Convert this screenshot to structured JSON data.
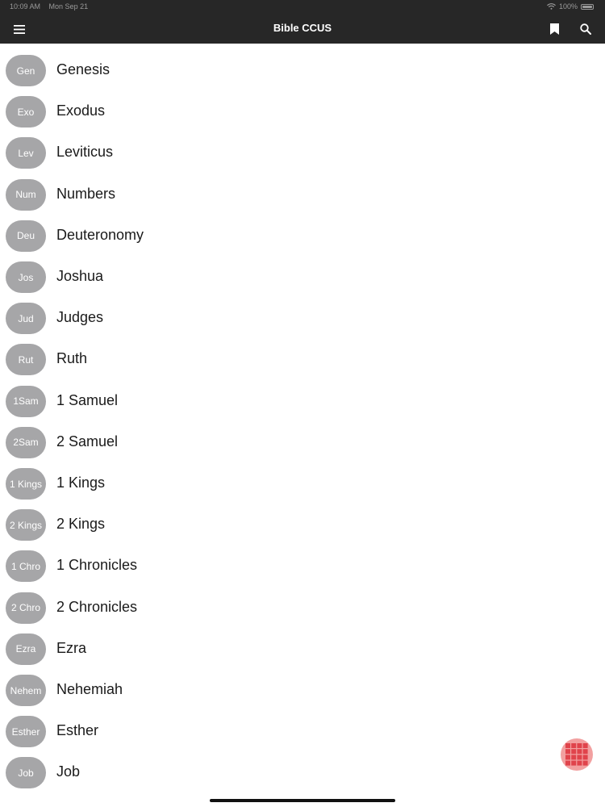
{
  "status_bar": {
    "time": "10:09 AM",
    "date": "Mon Sep 21",
    "battery": "100%"
  },
  "header": {
    "title": "Bible CCUS",
    "menu_icon": "hamburger-menu-icon",
    "bookmark_icon": "bookmark-icon",
    "search_icon": "search-icon"
  },
  "colors": {
    "topbar": "#272727",
    "pill": "#a6a6a8",
    "fab": "#f2a0a0"
  },
  "books": [
    {
      "abbr": "Gen",
      "name": "Genesis"
    },
    {
      "abbr": "Exo",
      "name": "Exodus"
    },
    {
      "abbr": "Lev",
      "name": "Leviticus"
    },
    {
      "abbr": "Num",
      "name": "Numbers"
    },
    {
      "abbr": "Deu",
      "name": "Deuteronomy"
    },
    {
      "abbr": "Jos",
      "name": "Joshua"
    },
    {
      "abbr": "Jud",
      "name": "Judges"
    },
    {
      "abbr": "Rut",
      "name": "Ruth"
    },
    {
      "abbr": "1Sam",
      "name": "1 Samuel"
    },
    {
      "abbr": "2Sam",
      "name": "2 Samuel"
    },
    {
      "abbr": "1 Kings",
      "name": "1 Kings"
    },
    {
      "abbr": "2 Kings",
      "name": "2 Kings"
    },
    {
      "abbr": "1 Chro",
      "name": "1 Chronicles"
    },
    {
      "abbr": "2 Chro",
      "name": "2 Chronicles"
    },
    {
      "abbr": "Ezra",
      "name": "Ezra"
    },
    {
      "abbr": "Nehem",
      "name": "Nehemiah"
    },
    {
      "abbr": "Esther",
      "name": "Esther"
    },
    {
      "abbr": "Job",
      "name": "Job"
    }
  ],
  "fab_icon": "grid-icon"
}
